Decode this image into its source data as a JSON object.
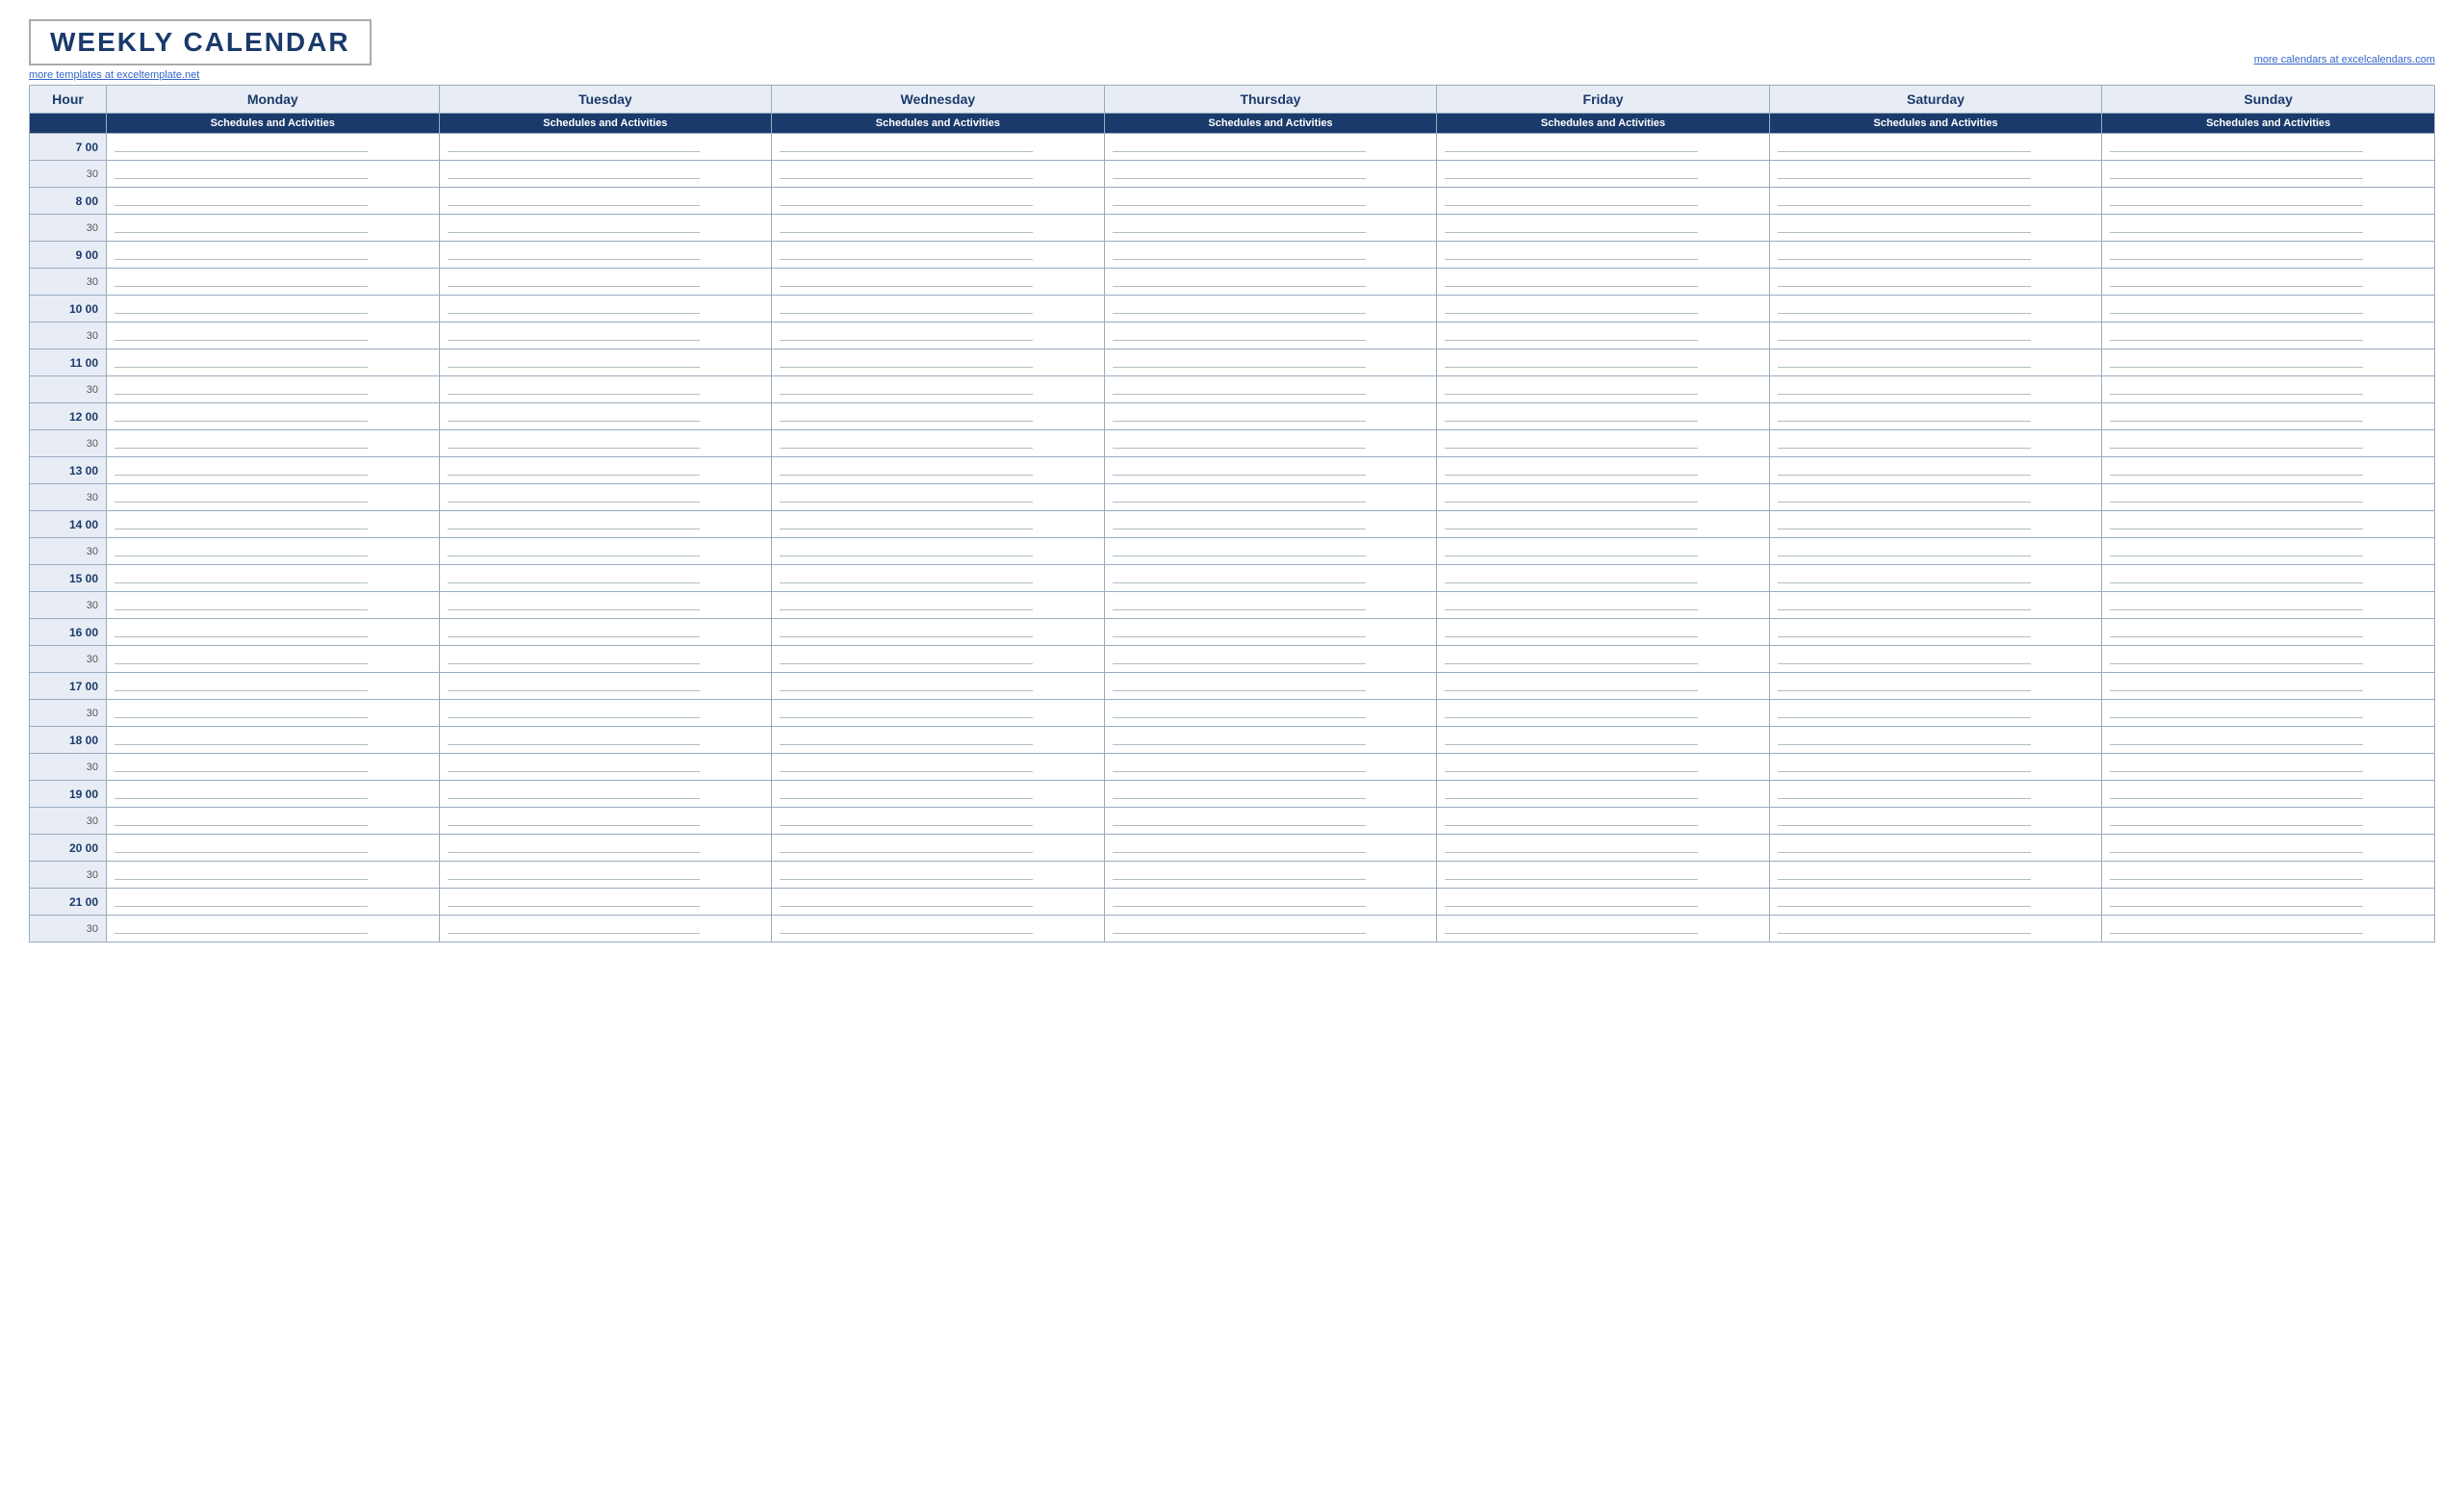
{
  "page": {
    "title": "WEEKLY CALENDAR",
    "link_left": "more templates at exceltemplate.net",
    "link_right": "more calendars at excelcalendars.com"
  },
  "table": {
    "hour_label": "Hour",
    "sub_label": "Schedules and Activities",
    "days": [
      "Monday",
      "Tuesday",
      "Wednesday",
      "Thursday",
      "Friday",
      "Saturday",
      "Sunday"
    ],
    "hours": [
      {
        "label": "7  00",
        "half": "30"
      },
      {
        "label": "8  00",
        "half": "30"
      },
      {
        "label": "9  00",
        "half": "30"
      },
      {
        "label": "10  00",
        "half": "30"
      },
      {
        "label": "11  00",
        "half": "30"
      },
      {
        "label": "12  00",
        "half": "30"
      },
      {
        "label": "13  00",
        "half": "30"
      },
      {
        "label": "14  00",
        "half": "30"
      },
      {
        "label": "15  00",
        "half": "30"
      },
      {
        "label": "16  00",
        "half": "30"
      },
      {
        "label": "17  00",
        "half": "30"
      },
      {
        "label": "18  00",
        "half": "30"
      },
      {
        "label": "19  00",
        "half": "30"
      },
      {
        "label": "20  00",
        "half": "30"
      },
      {
        "label": "21  00",
        "half": "30"
      }
    ]
  },
  "colors": {
    "header_bg": "#e8edf5",
    "header_text": "#1a3a6b",
    "sub_header_bg": "#1a3a6b",
    "border": "#9aabbf"
  }
}
